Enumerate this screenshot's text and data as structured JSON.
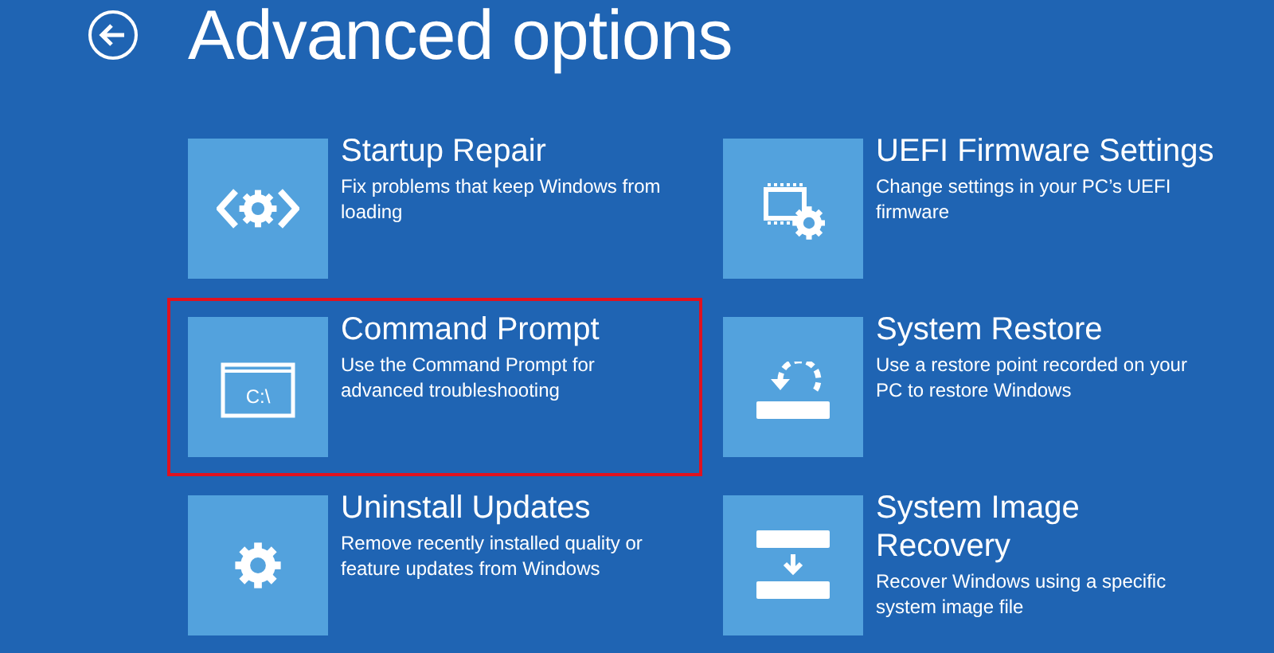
{
  "title": "Advanced options",
  "options": [
    {
      "kind": "repair",
      "title": "Startup Repair",
      "description": "Fix problems that keep Windows from loading",
      "highlighted": false
    },
    {
      "kind": "firmware",
      "title": "UEFI Firmware Settings",
      "description": "Change settings in your PC’s UEFI firmware",
      "highlighted": false
    },
    {
      "kind": "cmd",
      "title": "Command Prompt",
      "description": "Use the Command Prompt for advanced troubleshooting",
      "highlighted": true,
      "icon_text": "C:\\"
    },
    {
      "kind": "restore",
      "title": "System Restore",
      "description": "Use a restore point recorded on your PC to restore Windows",
      "highlighted": false
    },
    {
      "kind": "uninstall",
      "title": "Uninstall Updates",
      "description": "Remove recently installed quality or feature updates from Windows",
      "highlighted": false
    },
    {
      "kind": "image",
      "title": "System Image Recovery",
      "description": "Recover Windows using a specific system image file",
      "highlighted": false
    }
  ]
}
